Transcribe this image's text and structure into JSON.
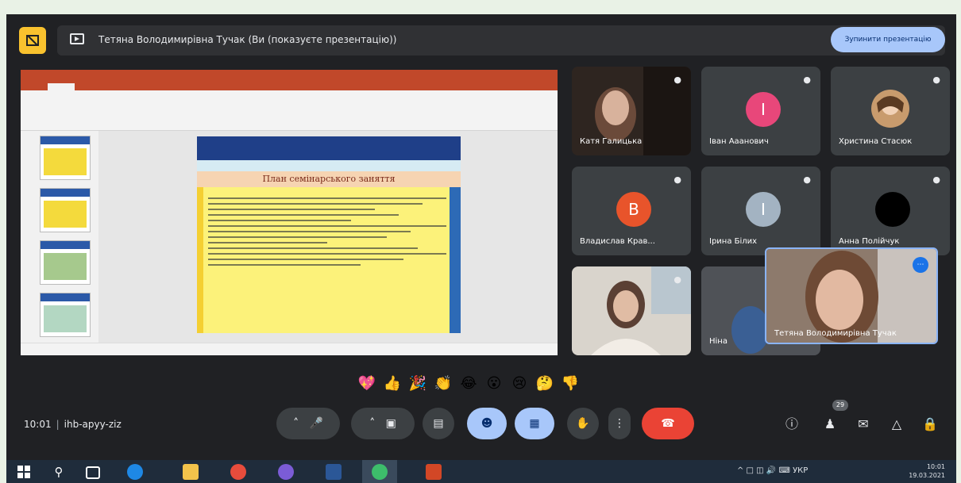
{
  "presentation_bar": {
    "presenter_text": "Тетяна Володимирівна Тучак (Ви (показуєте презентацію))",
    "stop_button_label": "Зупинити презентацію"
  },
  "slide": {
    "app_title": "",
    "slide_heading": "План семінарського заняття"
  },
  "participants": [
    {
      "name": "Катя Галицька",
      "type": "photo"
    },
    {
      "name": "Іван Ааанович",
      "type": "avatar",
      "initial": "І",
      "color": "#e8477a"
    },
    {
      "name": "Христина Стасюк",
      "type": "photo"
    },
    {
      "name": "Владислав Крав...",
      "type": "avatar",
      "initial": "В",
      "color": "#e8542b"
    },
    {
      "name": "Ірина Білих",
      "type": "avatar",
      "initial": "І",
      "color": "#a3b3c2"
    },
    {
      "name": "Анна Полійчук",
      "type": "avatar",
      "initial": "",
      "color": "#000000"
    },
    {
      "name": "",
      "type": "photo"
    },
    {
      "name": "Ніна",
      "type": "photo"
    }
  ],
  "self_view": {
    "name": "Тетяна Володимирівна Тучак"
  },
  "reactions": [
    "💖",
    "👍",
    "🎉",
    "👏",
    "😂",
    "😮",
    "😢",
    "🤔",
    "👎"
  ],
  "bottom_bar": {
    "time": "10:01",
    "meeting_code": "ihb-apyy-ziz",
    "participant_count": "29"
  },
  "taskbar": {
    "language": "УКР",
    "time": "10:01",
    "date": "19.03.2021"
  }
}
